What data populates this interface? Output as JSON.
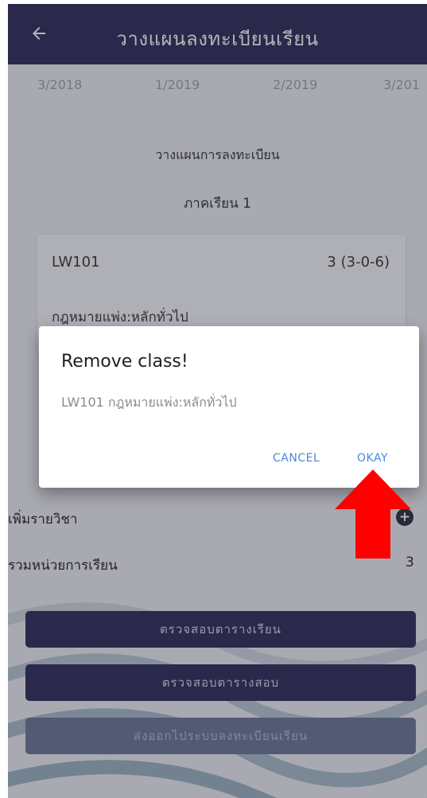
{
  "header": {
    "title": "วางแผนลงทะเบียนเรียน"
  },
  "terms": [
    "3/2018",
    "1/2019",
    "2/2019",
    "3/201"
  ],
  "plan": {
    "section_title": "วางแผนการลงทะเบียน",
    "semester_label": "ภาคเรียน 1"
  },
  "course": {
    "code": "LW101",
    "credit": "3 (3-0-6)",
    "name": "กฎหมายแพ่ง:หลักทั่วไป"
  },
  "dialog": {
    "title": "Remove class!",
    "message": "LW101 กฎหมายแพ่ง:หลักทั่วไป",
    "cancel": "CANCEL",
    "ok": "OKAY"
  },
  "add_course": {
    "label": "เพิ่มรายวิชา",
    "icon": "plus-circle-icon"
  },
  "total": {
    "label": "รวมหน่วยการเรียน",
    "value": "3"
  },
  "buttons": {
    "check_class": "ตรวจสอบตารางเรียน",
    "check_exam": "ตรวจสอบตารางสอบ",
    "submit": "ส่งออกไประบบลงทะเบียนเรียน"
  },
  "annotation": {
    "icon": "red-up-arrow",
    "color": "#ff0000"
  },
  "colors": {
    "primary": "#2b2a57",
    "accent": "#4a89dc"
  }
}
